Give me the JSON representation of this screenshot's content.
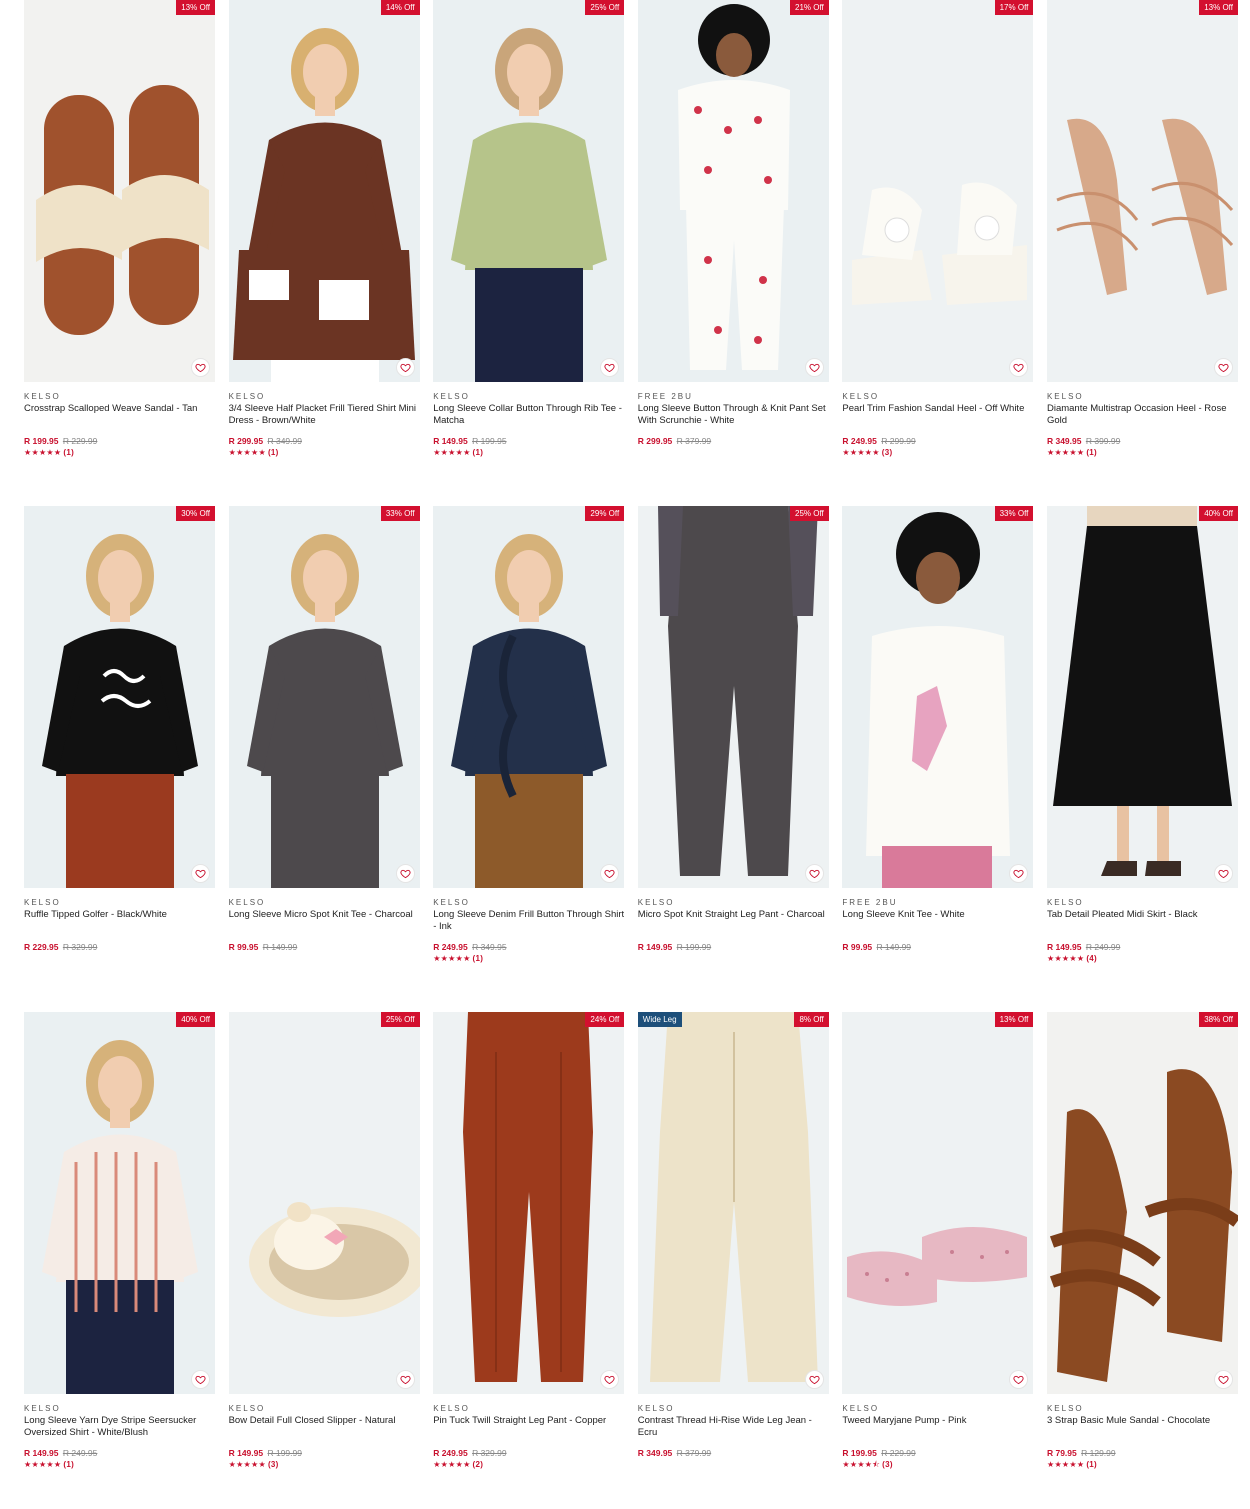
{
  "currency_note": "R",
  "products": [
    {
      "badge": "13% Off",
      "brand": "KELSO",
      "name": "Crosstrap Scalloped Weave Sandal - Tan",
      "price": "R 199.95",
      "was": "R 229.99",
      "stars": "★★★★★",
      "reviews": "(1)",
      "art": "sandal-tan"
    },
    {
      "badge": "14% Off",
      "brand": "KELSO",
      "name": "3/4 Sleeve Half Placket Frill Tiered Shirt Mini Dress - Brown/White",
      "price": "R 299.95",
      "was": "R 349.99",
      "stars": "★★★★★",
      "reviews": "(1)",
      "art": "dress-brown"
    },
    {
      "badge": "25% Off",
      "brand": "KELSO",
      "name": "Long Sleeve Collar Button Through Rib Tee - Matcha",
      "price": "R 149.95",
      "was": "R 199.95",
      "stars": "★★★★★",
      "reviews": "(1)",
      "art": "top-matcha"
    },
    {
      "badge": "21% Off",
      "brand": "FREE 2BU",
      "name": "Long Sleeve Button Through & Knit Pant Set With Scrunchie - White",
      "price": "R 299.95",
      "was": "R 379.99",
      "stars": "",
      "reviews": "",
      "art": "pj-white"
    },
    {
      "badge": "17% Off",
      "brand": "KELSO",
      "name": "Pearl Trim Fashion Sandal Heel - Off White",
      "price": "R 249.95",
      "was": "R 299.99",
      "stars": "★★★★★",
      "reviews": "(3)",
      "art": "heel-white"
    },
    {
      "badge": "13% Off",
      "brand": "KELSO",
      "name": "Diamante Multistrap Occasion Heel - Rose Gold",
      "price": "R 349.95",
      "was": "R 399.99",
      "stars": "★★★★★",
      "reviews": "(1)",
      "art": "heel-rose"
    },
    {
      "badge": "30% Off",
      "brand": "KELSO",
      "name": "Ruffle Tipped Golfer - Black/White",
      "price": "R 229.95",
      "was": "R 329.99",
      "stars": "",
      "reviews": "",
      "art": "golfer-black"
    },
    {
      "badge": "33% Off",
      "brand": "KELSO",
      "name": "Long Sleeve Micro Spot Knit Tee - Charcoal",
      "price": "R 99.95",
      "was": "R 149.99",
      "stars": "",
      "reviews": "",
      "art": "tee-charcoal"
    },
    {
      "badge": "29% Off",
      "brand": "KELSO",
      "name": "Long Sleeve Denim Frill Button Through Shirt - Ink",
      "price": "R 249.95",
      "was": "R 349.95",
      "stars": "★★★★★",
      "reviews": "(1)",
      "art": "shirt-ink"
    },
    {
      "badge": "25% Off",
      "brand": "KELSO",
      "name": "Micro Spot Knit Straight Leg Pant - Charcoal",
      "price": "R 149.95",
      "was": "R 199.99",
      "stars": "",
      "reviews": "",
      "art": "pant-charcoal"
    },
    {
      "badge": "33% Off",
      "brand": "FREE 2BU",
      "name": "Long Sleeve Knit Tee - White",
      "price": "R 99.95",
      "was": "R 149.99",
      "stars": "",
      "reviews": "",
      "art": "tee-white"
    },
    {
      "badge": "40% Off",
      "brand": "KELSO",
      "name": "Tab Detail Pleated Midi Skirt - Black",
      "price": "R 149.95",
      "was": "R 249.99",
      "stars": "★★★★★",
      "reviews": "(4)",
      "art": "skirt-black"
    },
    {
      "badge": "40% Off",
      "brand": "KELSO",
      "name": "Long Sleeve Yarn Dye Stripe Seersucker Oversized Shirt - White/Blush",
      "price": "R 149.95",
      "was": "R 249.95",
      "stars": "★★★★★",
      "reviews": "(1)",
      "art": "shirt-stripe"
    },
    {
      "badge": "25% Off",
      "brand": "KELSO",
      "name": "Bow Detail Full Closed Slipper - Natural",
      "price": "R 149.95",
      "was": "R 199.99",
      "stars": "★★★★★",
      "reviews": "(3)",
      "art": "slipper"
    },
    {
      "badge": "24% Off",
      "brand": "KELSO",
      "name": "Pin Tuck Twill Straight Leg Pant - Copper",
      "price": "R 249.95",
      "was": "R 329.99",
      "stars": "★★★★★",
      "reviews": "(2)",
      "art": "pant-copper"
    },
    {
      "badge": "8% Off",
      "tag": "Wide Leg",
      "brand": "KELSO",
      "name": "Contrast Thread Hi-Rise Wide Leg Jean - Ecru",
      "price": "R 349.95",
      "was": "R 379.99",
      "stars": "",
      "reviews": "",
      "art": "jean-ecru"
    },
    {
      "badge": "13% Off",
      "brand": "KELSO",
      "name": "Tweed Maryjane Pump - Pink",
      "price": "R 199.95",
      "was": "R 229.99",
      "stars": "★★★★⯪",
      "reviews": "(3)",
      "art": "pump-pink"
    },
    {
      "badge": "38% Off",
      "brand": "KELSO",
      "name": "3 Strap Basic Mule Sandal - Chocolate",
      "price": "R 79.95",
      "was": "R 129.99",
      "stars": "★★★★★",
      "reviews": "(1)",
      "art": "mule-choc"
    }
  ],
  "colors": {
    "badge": "#d3102f",
    "price": "#c8102e",
    "tag": "#1d4f7a"
  },
  "icons": {
    "wishlist": "heart-outline-icon",
    "rating": "star-icon"
  }
}
